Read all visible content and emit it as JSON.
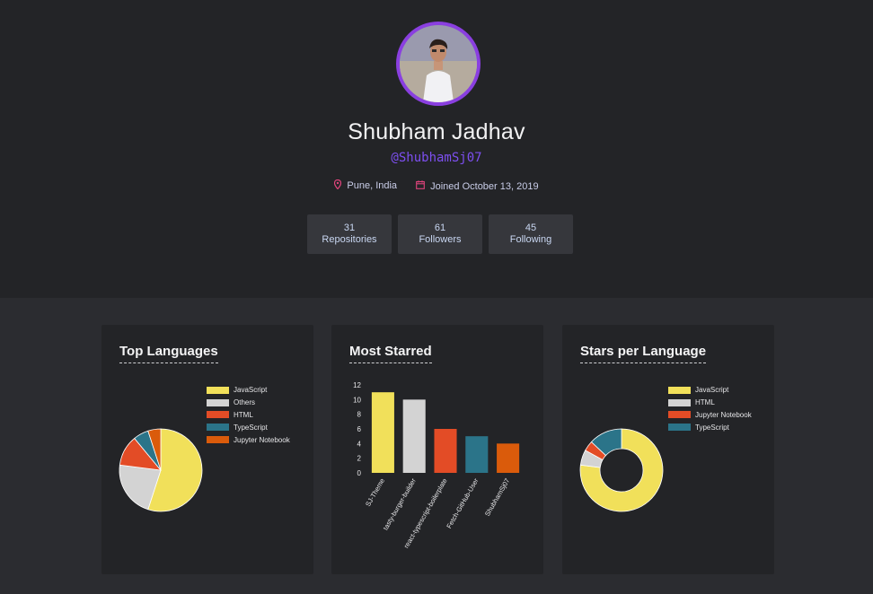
{
  "profile": {
    "name": "Shubham Jadhav",
    "handle": "@ShubhamSj07",
    "location": "Pune, India",
    "joined": "Joined October 13, 2019",
    "location_icon": "map-pin-icon",
    "calendar_icon": "calendar-icon"
  },
  "stats": [
    {
      "value": "31",
      "label": "Repositories"
    },
    {
      "value": "61",
      "label": "Followers"
    },
    {
      "value": "45",
      "label": "Following"
    }
  ],
  "colors": {
    "accent": "#8a3fe0",
    "handle": "#7d4ff0",
    "javascript": "#f1e05a",
    "others": "#d3d3d3",
    "html": "#e34c26",
    "typescript": "#2b7489",
    "jupyter": "#da5b0b"
  },
  "cards": {
    "top_languages": {
      "title": "Top Languages"
    },
    "most_starred": {
      "title": "Most Starred"
    },
    "stars_per_language": {
      "title": "Stars per Language"
    }
  },
  "chart_data": [
    {
      "type": "pie",
      "title": "Top Languages",
      "labels": [
        "JavaScript",
        "Others",
        "HTML",
        "TypeScript",
        "Jupyter Notebook"
      ],
      "values": [
        55,
        22,
        12,
        6,
        5
      ],
      "colors": [
        "#f1e05a",
        "#d3d3d3",
        "#e34c26",
        "#2b7489",
        "#da5b0b"
      ],
      "legend": "right"
    },
    {
      "type": "bar",
      "title": "Most Starred",
      "categories": [
        "SJ-Theme",
        "tasty-burger-builder",
        "react-typescript-boilerplate",
        "Fetch-GitHub-User",
        "ShubhamSj07"
      ],
      "values": [
        11,
        10,
        6,
        5,
        4
      ],
      "colors": [
        "#f1e05a",
        "#d3d3d3",
        "#e34c26",
        "#2b7489",
        "#da5b0b"
      ],
      "ylim": [
        0,
        12
      ],
      "yticks": [
        "0",
        "2",
        "4",
        "6",
        "8",
        "10",
        "12"
      ],
      "grid": false
    },
    {
      "type": "pie",
      "title": "Stars per Language",
      "donut": true,
      "labels": [
        "JavaScript",
        "HTML",
        "Jupyter Notebook",
        "TypeScript"
      ],
      "values": [
        77,
        6,
        4,
        13
      ],
      "colors": [
        "#f1e05a",
        "#d3d3d3",
        "#e34c26",
        "#2b7489"
      ],
      "legend": "right"
    }
  ]
}
